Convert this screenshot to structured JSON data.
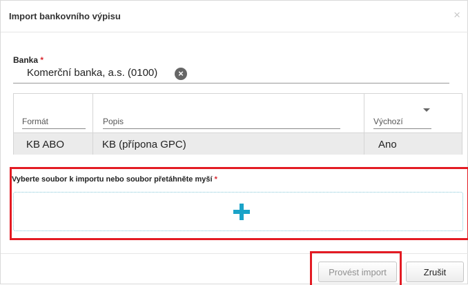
{
  "dialog": {
    "title": "Import bankovního výpisu",
    "close_glyph": "×"
  },
  "bank": {
    "label": "Banka",
    "required_mark": "*",
    "value": "Komerční banka, a.s. (0100)",
    "clear_glyph": "×",
    "clear_icon": "circle-x-icon"
  },
  "table": {
    "columns": [
      "Formát",
      "Popis",
      "Výchozí"
    ],
    "rows": [
      [
        "KB ABO",
        "KB (přípona GPC)",
        "Ano"
      ]
    ],
    "sort_icon": "caret-down-icon"
  },
  "file": {
    "label": "Vyberte soubor k importu nebo soubor přetáhněte myší",
    "required_mark": "*",
    "add_icon": "plus-icon",
    "accent_color": "#1aa3c8"
  },
  "footer": {
    "import_label": "Provést import",
    "cancel_label": "Zrušit"
  },
  "highlight_color": "#e31b23"
}
